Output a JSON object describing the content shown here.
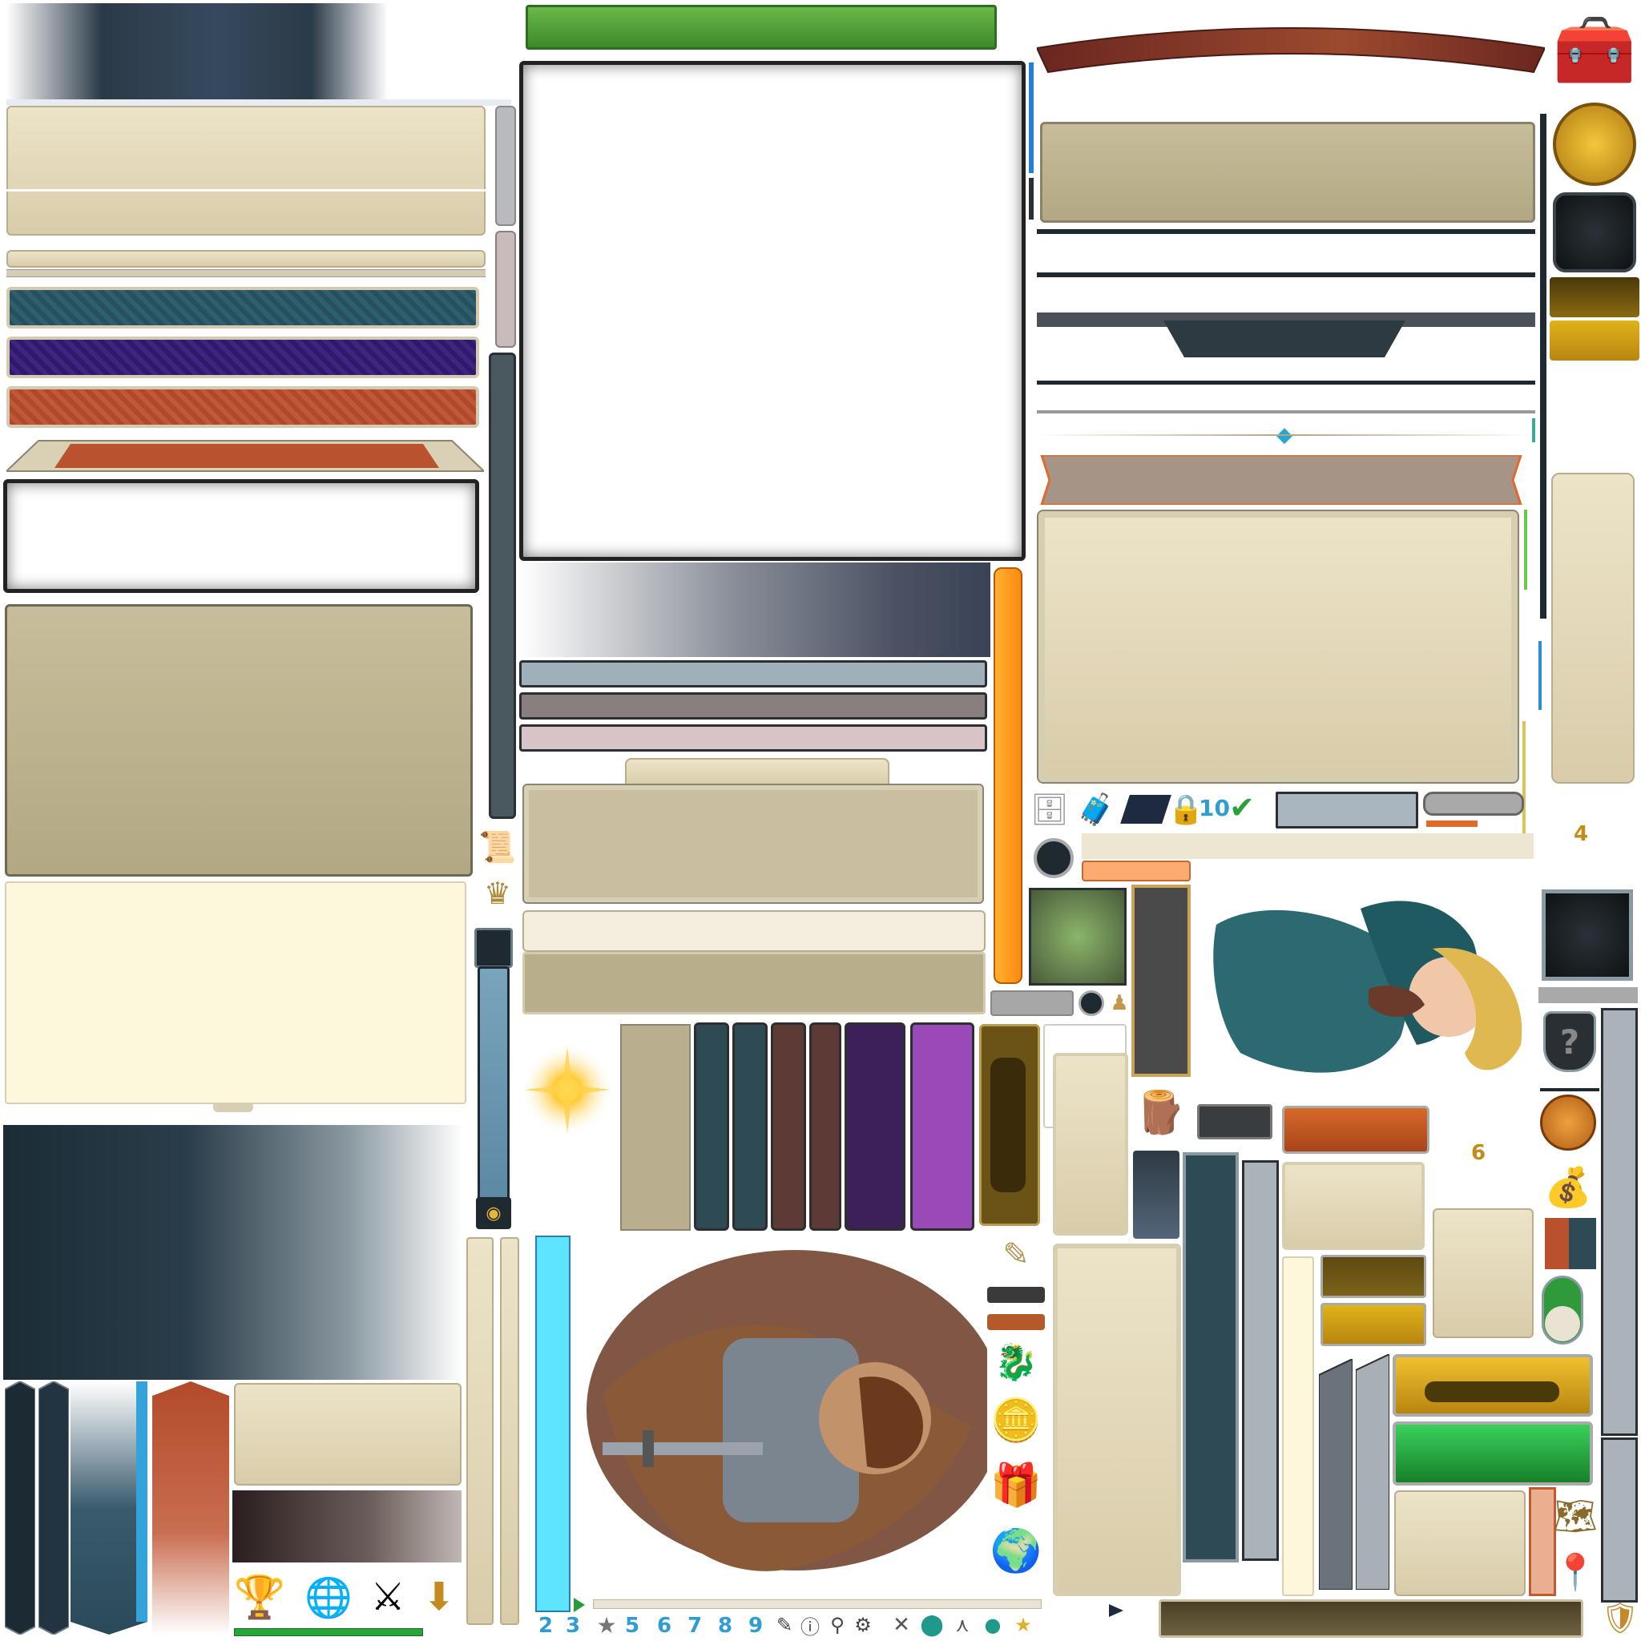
{
  "atlas": {
    "title": "",
    "digits": [
      "2",
      "3",
      "5",
      "6",
      "7",
      "8",
      "9"
    ],
    "badge_ten": "10",
    "badge_six": "6",
    "badge_four": "4",
    "help_glyph": "?",
    "check_glyph": "✔"
  },
  "colors": {
    "parchment": "#e2d7b8",
    "khaki": "#b8ae8c",
    "cream": "#fdf7dc",
    "teal_dark": "#2e4a55",
    "purple": "#3a1f7a",
    "rust": "#b9512e",
    "green_ribbon": "#5aa23a",
    "red_ribbon": "#8a3328",
    "gold": "#d9a21c",
    "green_button": "#1f9a3a",
    "cyan_bar": "#5fe4ff",
    "orange_bar": "#ff9a18",
    "slate": "#4a5860"
  },
  "icons": [
    "treasure-chest-icon",
    "dragon-coin-icon",
    "dark-medallion-icon",
    "sun-sparkle-icon",
    "silver-chest-icon",
    "gold-chest-icon",
    "padlock-icon",
    "checkmark-icon",
    "trophy-icon",
    "globe-laurel-icon",
    "crossed-swords-shield-icon",
    "download-arrow-icon",
    "gift-box-icon",
    "globe-icon",
    "coins-icon",
    "dragon-emblem-icon",
    "help-shield-icon",
    "map-pin-icon",
    "shield-icon",
    "star-icon",
    "gear-icon",
    "wood-logs-icon",
    "prayer-hands-icon",
    "gold-coins-icon",
    "scroll-icon",
    "quill-icon",
    "crown-icon",
    "map-icon"
  ],
  "characters": [
    "knight-portrait",
    "lady-portrait"
  ]
}
